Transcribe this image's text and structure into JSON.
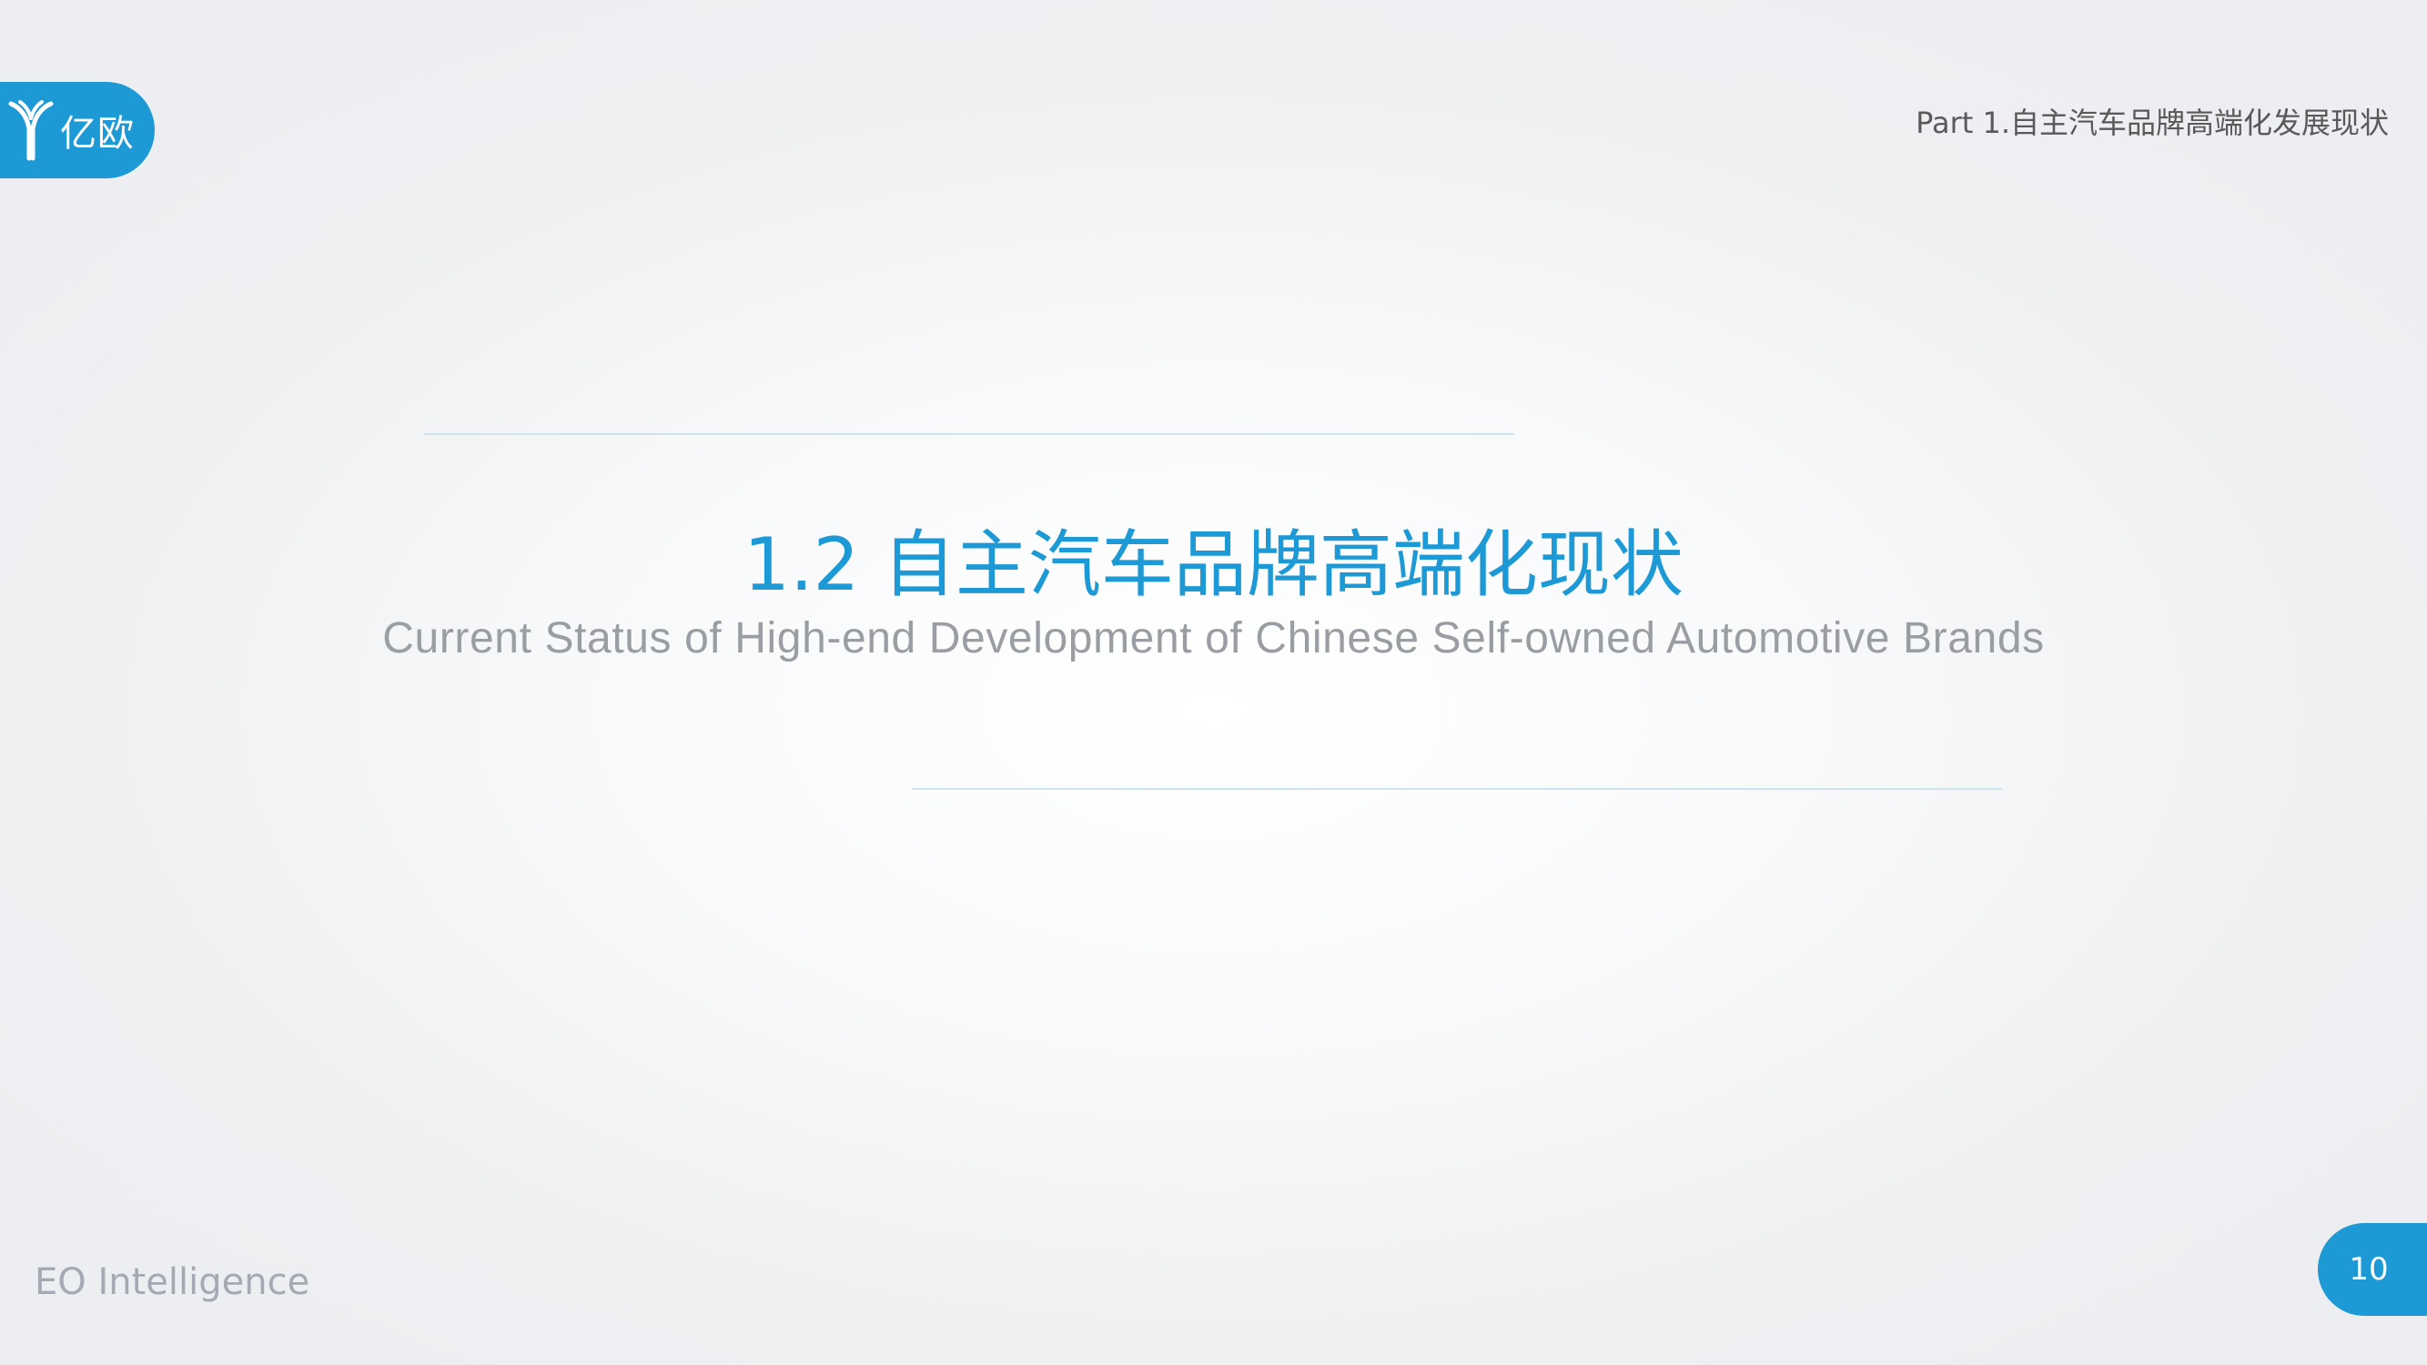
{
  "header": {
    "logo_text": "亿欧",
    "part_label": "Part 1.自主汽车品牌高端化发展现状"
  },
  "section": {
    "title": "1.2 自主汽车品牌高端化现状",
    "subtitle": "Current Status of High-end Development of Chinese Self-owned Automotive Brands"
  },
  "footer": {
    "brand": "EO Intelligence",
    "page_number": "10"
  },
  "colors": {
    "accent": "#1d9ad6",
    "subtitle_gray": "#9a9ea3",
    "footer_gray": "#a5a9b3",
    "rule": "#cfe3ef"
  },
  "icons": {
    "logo": "eo-logo-icon"
  }
}
